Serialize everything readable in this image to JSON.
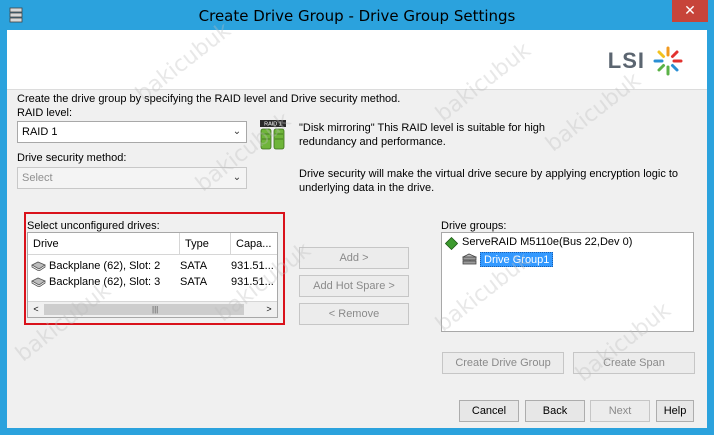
{
  "window": {
    "title": "Create Drive Group - Drive Group Settings",
    "close_glyph": "✕"
  },
  "brand": {
    "logo_text": "LSI"
  },
  "intro_text": "Create the drive group by specifying the RAID level and Drive security method.",
  "raid_level": {
    "label": "RAID level:",
    "value": "RAID 1",
    "badge": "RAID 1",
    "description": "\"Disk mirroring\" This RAID level is suitable for high redundancy and performance."
  },
  "drive_security": {
    "label": "Drive security method:",
    "value": "Select",
    "description": "Drive security will make the virtual drive secure by applying encryption logic to underlying data in the drive."
  },
  "unconfigured": {
    "label": "Select unconfigured drives:",
    "columns": [
      "Drive",
      "Type",
      "Capa..."
    ],
    "rows": [
      {
        "drive": "Backplane (62), Slot: 2",
        "type": "SATA",
        "capacity": "931.51..."
      },
      {
        "drive": "Backplane (62), Slot: 3",
        "type": "SATA",
        "capacity": "931.51..."
      }
    ]
  },
  "mid_buttons": {
    "add": "Add >",
    "add_hot_spare": "Add Hot Spare >",
    "remove": "< Remove"
  },
  "drive_groups": {
    "label": "Drive groups:",
    "controller": "ServeRAID M5110e(Bus 22,Dev 0)",
    "group": "Drive Group1"
  },
  "group_buttons": {
    "create_group": "Create Drive Group",
    "create_span": "Create Span"
  },
  "footer": {
    "cancel": "Cancel",
    "back": "Back",
    "next": "Next",
    "help": "Help"
  },
  "watermark_text": "bakicubuk",
  "colors": {
    "title_bar": "#2ba2dd",
    "highlight": "#d9121b",
    "selection": "#3399ff",
    "close": "#c7443a"
  }
}
